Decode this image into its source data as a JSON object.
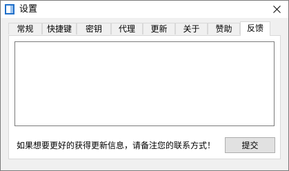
{
  "window": {
    "title": "设置"
  },
  "tabs": [
    {
      "label": "常规",
      "active": false
    },
    {
      "label": "快捷键",
      "active": false
    },
    {
      "label": "密钥",
      "active": false
    },
    {
      "label": "代理",
      "active": false
    },
    {
      "label": "更新",
      "active": false
    },
    {
      "label": "关于",
      "active": false
    },
    {
      "label": "赞助",
      "active": false
    },
    {
      "label": "反馈",
      "active": true
    }
  ],
  "feedback": {
    "text_value": "",
    "prompt": "如果想要更好的获得更新信息，请备注您的联系方式！",
    "submit_label": "提交"
  },
  "colors": {
    "window_bg": "#f0f0f0",
    "titlebar_bg": "#ffffff",
    "panel_bg": "#ffffff",
    "border": "#d9d9d9",
    "button_bg": "#e1e1e1",
    "icon_blue": "#1f6fc9"
  },
  "icons": {
    "app": "app-icon",
    "close": "close-icon"
  }
}
